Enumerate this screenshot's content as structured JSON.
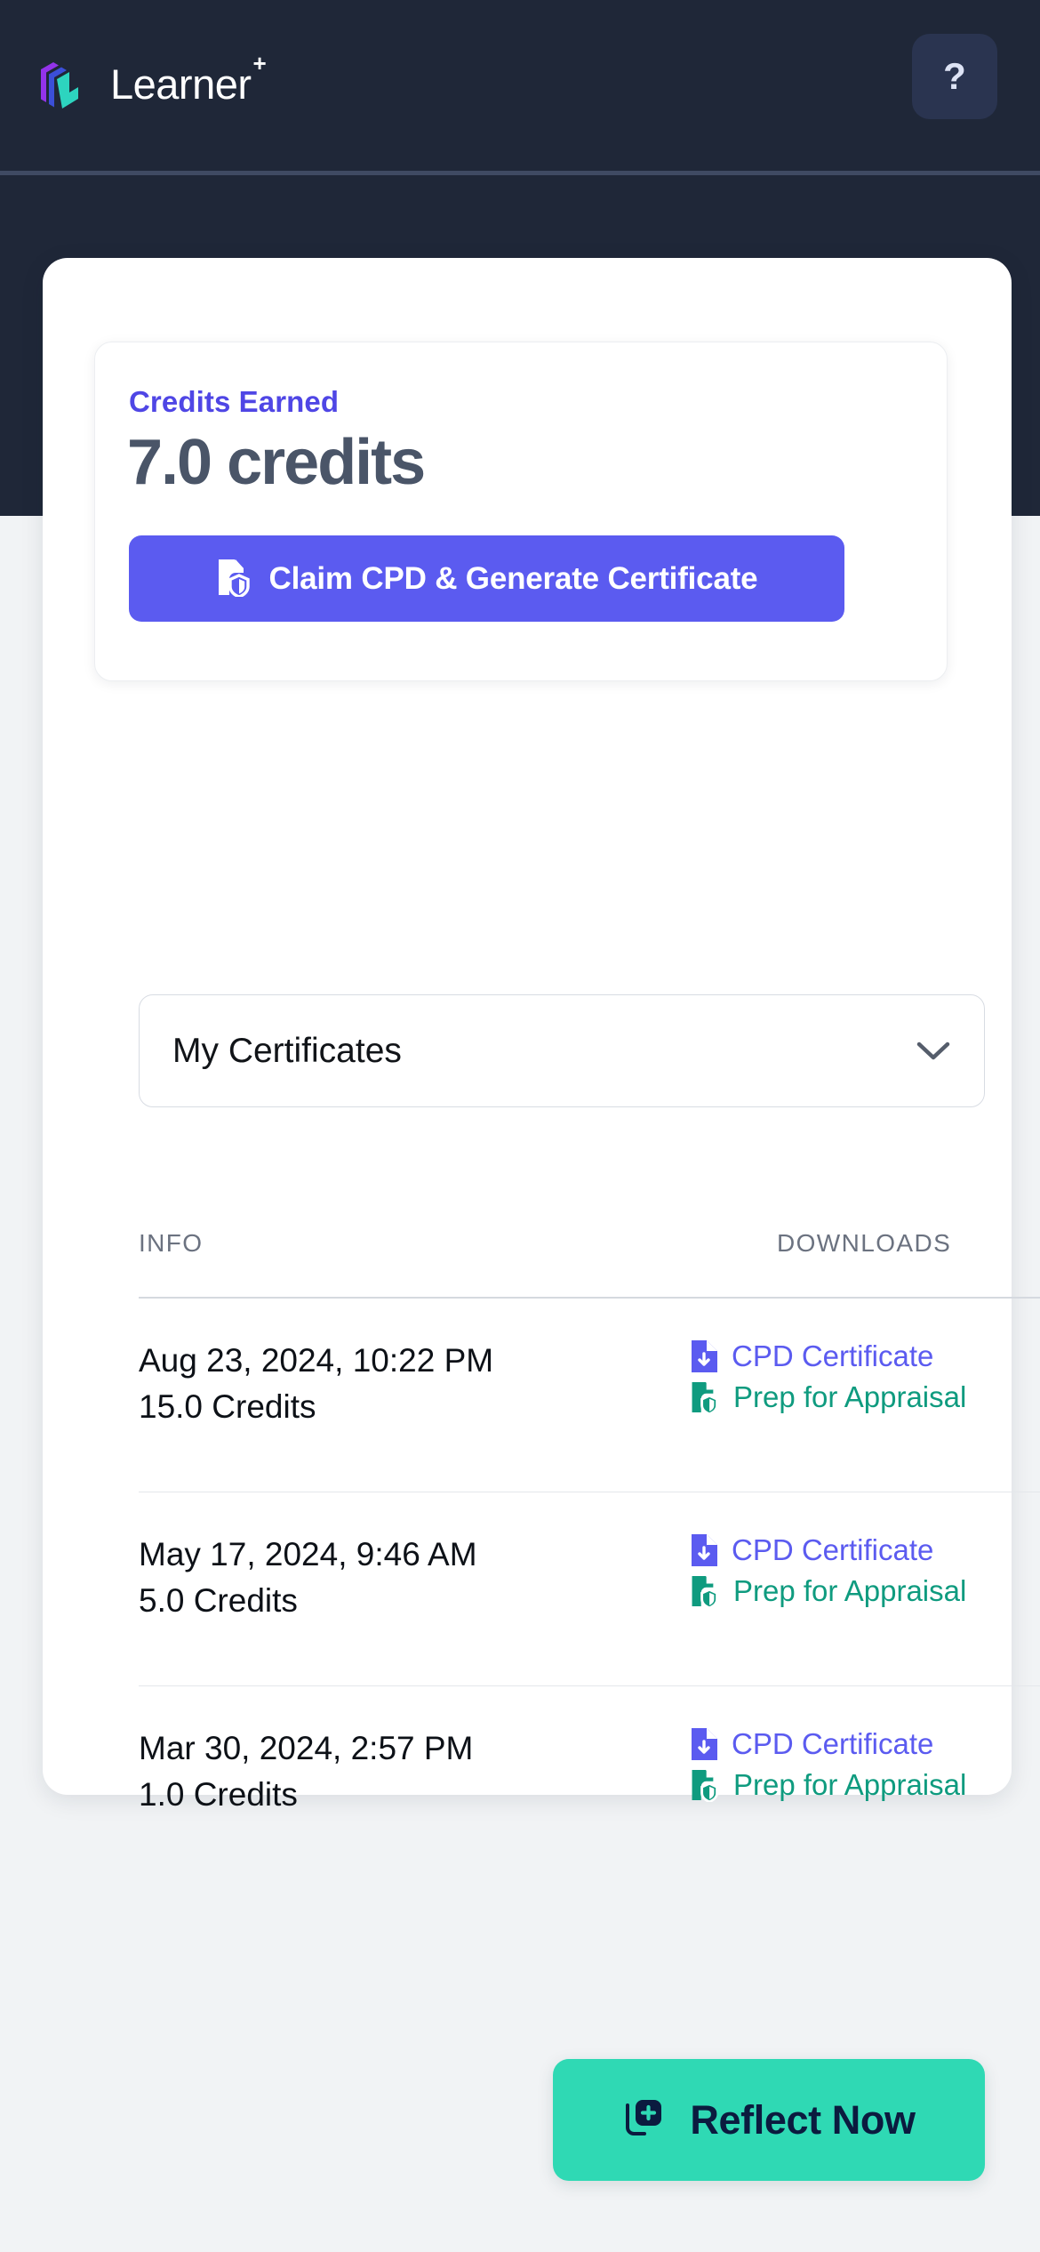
{
  "header": {
    "brand_name": "Learner",
    "brand_superscript": "+",
    "help_label": "?",
    "background_color": "#1f2738",
    "logo_colors": [
      "#9333ea",
      "#3b4fd8",
      "#2dd4bf"
    ]
  },
  "credits": {
    "label": "Credits Earned",
    "value": "7.0 credits",
    "claim_button_label": "Claim CPD & Generate Certificate",
    "accent_color": "#5b5bf0"
  },
  "select": {
    "value": "My Certificates"
  },
  "table": {
    "columns": [
      "INFO",
      "DOWNLOADS"
    ],
    "rows": [
      {
        "date": "Aug 23, 2024, 10:22 PM",
        "credits": "15.0 Credits",
        "downloads": [
          {
            "label": "CPD Certificate",
            "icon": "file-download-icon",
            "color": "#5b5bf0"
          },
          {
            "label": "Prep for Appraisal",
            "icon": "file-shield-icon",
            "color": "#0f9b7f"
          }
        ]
      },
      {
        "date": "May 17, 2024, 9:46 AM",
        "credits": "5.0 Credits",
        "downloads": [
          {
            "label": "CPD Certificate",
            "icon": "file-download-icon",
            "color": "#5b5bf0"
          },
          {
            "label": "Prep for Appraisal",
            "icon": "file-shield-icon",
            "color": "#0f9b7f"
          }
        ]
      },
      {
        "date": "Mar 30, 2024, 2:57 PM",
        "credits": "1.0 Credits",
        "downloads": [
          {
            "label": "CPD Certificate",
            "icon": "file-download-icon",
            "color": "#5b5bf0"
          },
          {
            "label": "Prep for Appraisal",
            "icon": "file-shield-icon",
            "color": "#0f9b7f"
          }
        ]
      }
    ]
  },
  "reflect": {
    "label": "Reflect Now",
    "background_color": "#2fd9b4",
    "text_color": "#0b1b3f"
  }
}
